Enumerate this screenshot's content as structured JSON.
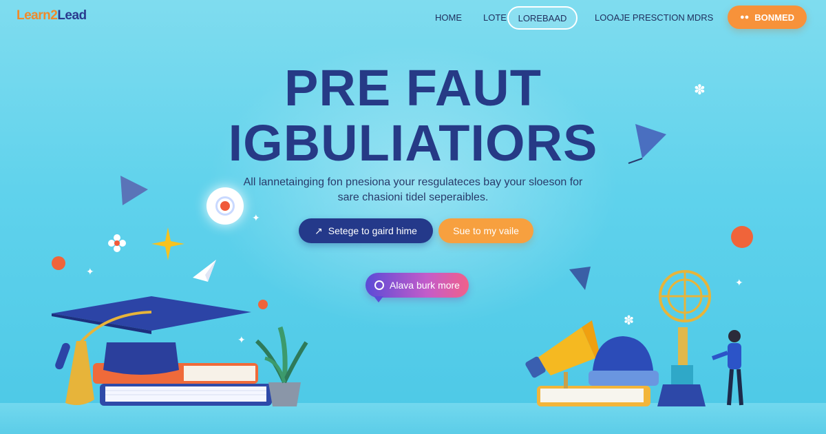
{
  "nav": {
    "logo_part1": "Learn2",
    "logo_part2": "Lead",
    "links": [
      "HOME",
      "LOTE",
      "LOREBAAD",
      "LOOAJE PRESCTION",
      "MDRS"
    ],
    "cta_label": "BONMED",
    "cta_icon": "user-group-icon"
  },
  "hero": {
    "title_line1": "PRE FAUT",
    "title_line2": "IGBULIATIORS",
    "subtitle_line1": "All lannetainging fon pnesiona your resgulateces bay your sloeson for",
    "subtitle_line2": "sare chasioni tidel seperaibles.",
    "primary_button": "Setege to gaird hime",
    "primary_icon": "arrow-up-right-icon",
    "secondary_button": "Sue to my vaile",
    "chat_button": "Alava burk more",
    "chat_icon": "chat-bubble-icon"
  },
  "colors": {
    "background": "#5fd2ec",
    "brand_dark": "#263a86",
    "brand_orange": "#f7923a"
  }
}
